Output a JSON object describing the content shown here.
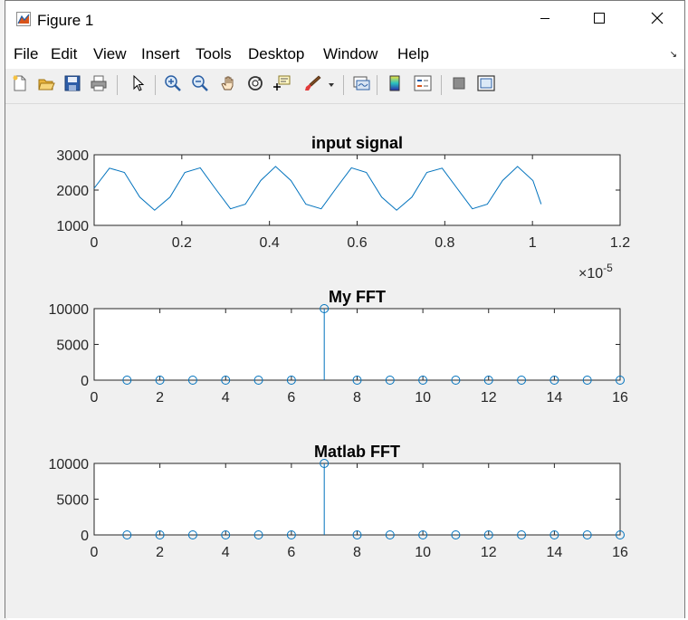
{
  "window": {
    "title": "Figure 1"
  },
  "menu": [
    "File",
    "Edit",
    "View",
    "Insert",
    "Tools",
    "Desktop",
    "Window",
    "Help"
  ],
  "toolbar": [
    "new-figure",
    "open-file",
    "save",
    "print",
    "edit-plot-pointer",
    "zoom-in",
    "zoom-out",
    "pan",
    "rotate-3d",
    "data-cursor",
    "brush",
    "link-plot",
    "insert-colorbar",
    "insert-legend",
    "hide-plot-tools",
    "show-plot-tools"
  ],
  "colors": {
    "line": "#0072bd",
    "axes": "#262626",
    "figure_bg": "#f0f0f0"
  },
  "chart_data": [
    {
      "type": "line",
      "title": "input signal",
      "xlim": [
        0,
        1.2e-05
      ],
      "ylim": [
        1000,
        3000
      ],
      "x_tick_labels": [
        "0",
        "0.2",
        "0.4",
        "0.6",
        "0.8",
        "1",
        "1.2"
      ],
      "y_tick_labels": [
        "1000",
        "2000",
        "3000"
      ],
      "x_exponent": {
        "base": "×10",
        "power": "-5"
      },
      "x": [
        0,
        3.5e-07,
        6.9e-07,
        1.04e-06,
        1.38e-06,
        1.73e-06,
        2.07e-06,
        2.42e-06,
        2.76e-06,
        3.11e-06,
        3.45e-06,
        3.8e-06,
        4.14e-06,
        4.49e-06,
        4.83e-06,
        5.18e-06,
        5.52e-06,
        5.87e-06,
        6.21e-06,
        6.56e-06,
        6.9e-06,
        7.25e-06,
        7.59e-06,
        7.94e-06,
        8.28e-06,
        8.63e-06,
        8.97e-06,
        9.32e-06,
        9.66e-06,
        1.001e-05,
        1.02e-05
      ],
      "y": [
        2050,
        2620,
        2500,
        1800,
        1430,
        1800,
        2500,
        2630,
        2050,
        1470,
        1600,
        2270,
        2670,
        2270,
        1600,
        1470,
        2050,
        2630,
        2500,
        1800,
        1430,
        1800,
        2500,
        2620,
        2050,
        1470,
        1600,
        2270,
        2670,
        2270,
        1600
      ]
    },
    {
      "type": "stem",
      "title": "My FFT",
      "xlim": [
        0,
        16
      ],
      "ylim": [
        0,
        10000
      ],
      "x_tick_labels": [
        "0",
        "2",
        "4",
        "6",
        "8",
        "10",
        "12",
        "14",
        "16"
      ],
      "y_tick_labels": [
        "0",
        "5000",
        "10000"
      ],
      "x": [
        1,
        2,
        3,
        4,
        5,
        6,
        7,
        8,
        9,
        10,
        11,
        12,
        13,
        14,
        15,
        16
      ],
      "y": [
        0,
        0,
        0,
        0,
        0,
        0,
        10000,
        0,
        0,
        0,
        0,
        0,
        0,
        0,
        0,
        0
      ]
    },
    {
      "type": "stem",
      "title": "Matlab FFT",
      "xlim": [
        0,
        16
      ],
      "ylim": [
        0,
        10000
      ],
      "x_tick_labels": [
        "0",
        "2",
        "4",
        "6",
        "8",
        "10",
        "12",
        "14",
        "16"
      ],
      "y_tick_labels": [
        "0",
        "5000",
        "10000"
      ],
      "x": [
        1,
        2,
        3,
        4,
        5,
        6,
        7,
        8,
        9,
        10,
        11,
        12,
        13,
        14,
        15,
        16
      ],
      "y": [
        0,
        0,
        0,
        0,
        0,
        0,
        10000,
        0,
        0,
        0,
        0,
        0,
        0,
        0,
        0,
        0
      ]
    }
  ]
}
